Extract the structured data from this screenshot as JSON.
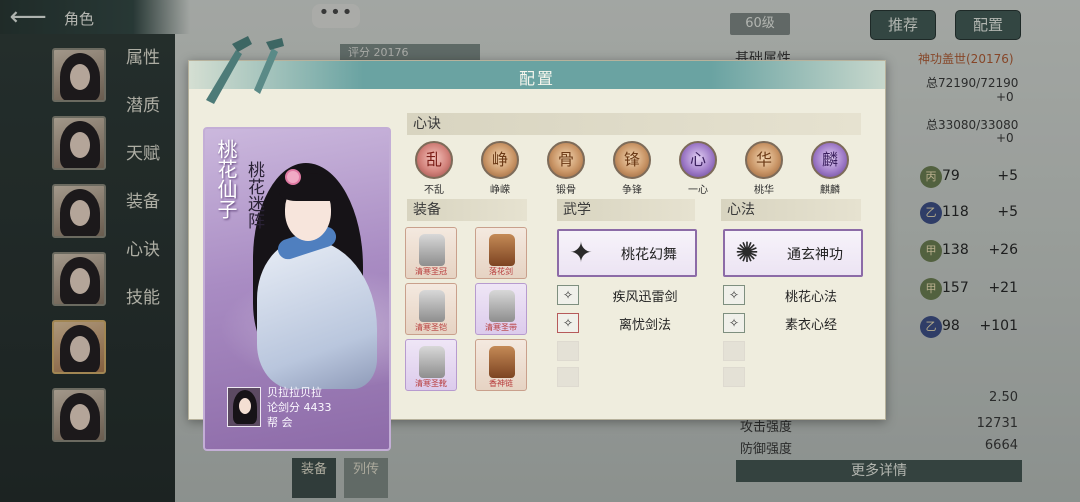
{
  "screen": {
    "title": "角色",
    "chat_icon": "•••",
    "score_strip": "评分 20176",
    "level": "60级",
    "recommend_label": "推荐",
    "config_label": "配置",
    "side_tabs": [
      "属性",
      "潜质",
      "天赋",
      "装备",
      "心诀",
      "技能"
    ],
    "right_panel": {
      "title": "基础属性",
      "subtitle": "神功盖世(20176)",
      "hp": "总72190/72190",
      "hp_bonus": "+0",
      "mp": "总33080/33080",
      "mp_bonus": "+0",
      "stats": [
        {
          "grade": "丙",
          "value": "79",
          "bonus": "+5"
        },
        {
          "grade": "乙",
          "value": "118",
          "bonus": "+5"
        },
        {
          "grade": "甲",
          "value": "138",
          "bonus": "+26"
        },
        {
          "grade": "甲",
          "value": "157",
          "bonus": "+21"
        },
        {
          "grade": "乙",
          "value": "98",
          "bonus": "+101"
        }
      ],
      "bottom_stats": [
        {
          "label": "",
          "value": "2.50"
        },
        {
          "label": "攻击强度",
          "value": "12731"
        },
        {
          "label": "防御强度",
          "value": "6664"
        }
      ],
      "more_label": "更多详情"
    },
    "bottom_nav": [
      "装备",
      "列传"
    ]
  },
  "modal": {
    "title": "配置",
    "character": {
      "name": "桃花仙子",
      "formation": "桃花迷阵",
      "owner_name": "贝拉拉贝拉",
      "owner_score": "论剑分 4433",
      "owner_guild": "帮  会"
    },
    "heart_section": "心诀",
    "hearts": [
      {
        "label": "不乱",
        "glyph": "乱",
        "tone": "red"
      },
      {
        "label": "峥嵘",
        "glyph": "峥",
        "tone": "gold"
      },
      {
        "label": "锻骨",
        "glyph": "骨",
        "tone": "gold"
      },
      {
        "label": "争锋",
        "glyph": "锋",
        "tone": "gold"
      },
      {
        "label": "一心",
        "glyph": "心",
        "tone": "purple"
      },
      {
        "label": "桃华",
        "glyph": "华",
        "tone": "gold"
      },
      {
        "label": "麒麟",
        "glyph": "麟",
        "tone": "purple"
      }
    ],
    "equip_section": "装备",
    "equipment": [
      "清寒圣冠",
      "落花剑",
      "清寒圣铠",
      "清寒圣带",
      "清寒圣靴",
      "香神链"
    ],
    "martial_section": "武学",
    "martial_main": "桃花幻舞",
    "martial_list": [
      "疾风迅雷剑",
      "离忧剑法"
    ],
    "method_section": "心法",
    "method_main": "通玄神功",
    "method_list": [
      "桃花心法",
      "素衣心经"
    ]
  },
  "colors": {
    "header_teal": "#6aa3a2",
    "panel_bg": "#efedde",
    "card_purple": "#a98cc3",
    "rare_border": "#8c6ba7"
  }
}
